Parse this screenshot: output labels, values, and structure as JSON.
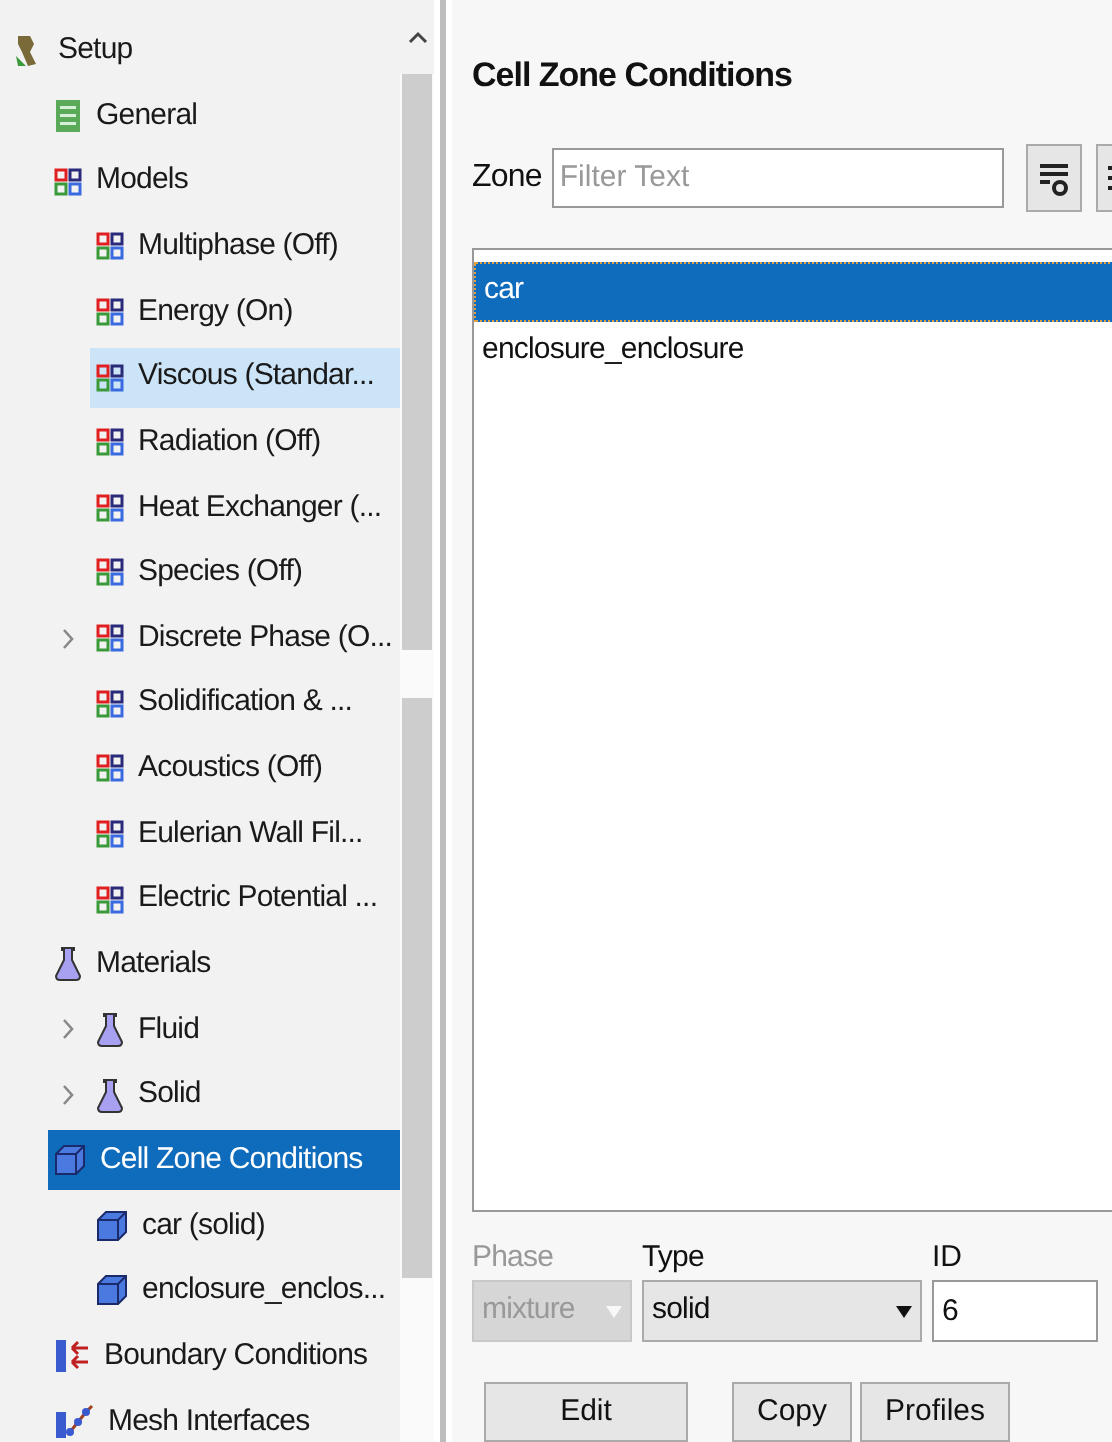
{
  "tree": [
    {
      "label": "Setup",
      "kind": "setup",
      "selected": false,
      "children": [
        {
          "label": "General",
          "kind": "general",
          "selected": false
        },
        {
          "label": "Models",
          "kind": "model",
          "selected": false,
          "children": [
            {
              "label": "Multiphase (Off)",
              "kind": "model",
              "selected": false
            },
            {
              "label": "Energy (On)",
              "kind": "model",
              "selected": false
            },
            {
              "label": "Viscous (Standar...",
              "kind": "model",
              "selected": false,
              "hovered": true
            },
            {
              "label": "Radiation (Off)",
              "kind": "model",
              "selected": false
            },
            {
              "label": "Heat Exchanger (...",
              "kind": "model",
              "selected": false
            },
            {
              "label": "Species (Off)",
              "kind": "model",
              "selected": false
            },
            {
              "label": "Discrete Phase (O...",
              "kind": "model",
              "selected": false,
              "expanded": false
            },
            {
              "label": "Solidification & ...",
              "kind": "model",
              "selected": false
            },
            {
              "label": "Acoustics (Off)",
              "kind": "model",
              "selected": false
            },
            {
              "label": "Eulerian Wall Fil...",
              "kind": "model",
              "selected": false
            },
            {
              "label": "Electric Potential ...",
              "kind": "model",
              "selected": false
            }
          ]
        },
        {
          "label": "Materials",
          "kind": "material",
          "selected": false,
          "children": [
            {
              "label": "Fluid",
              "kind": "material",
              "selected": false,
              "expanded": false
            },
            {
              "label": "Solid",
              "kind": "material",
              "selected": false,
              "expanded": false
            }
          ]
        },
        {
          "label": "Cell Zone Conditions",
          "kind": "cellzone",
          "selected": true,
          "children": [
            {
              "label": "car (solid)",
              "kind": "cellzone",
              "selected": false
            },
            {
              "label": "enclosure_enclos...",
              "kind": "cellzone",
              "selected": false
            }
          ]
        },
        {
          "label": "Boundary Conditions",
          "kind": "boundary",
          "selected": false
        },
        {
          "label": "Mesh Interfaces",
          "kind": "mesh",
          "selected": false
        }
      ]
    }
  ],
  "panel": {
    "title": "Cell Zone Conditions",
    "zone_label": "Zone",
    "filter": {
      "placeholder": "Filter Text"
    },
    "zones": [
      {
        "label": "car",
        "selected": true
      },
      {
        "label": "enclosure_enclosure",
        "selected": false
      }
    ],
    "phase": {
      "label": "Phase",
      "value": "mixture",
      "disabled": true
    },
    "type": {
      "label": "Type",
      "value": "solid",
      "disabled": false
    },
    "id": {
      "label": "ID",
      "value": "6"
    },
    "buttons": [
      "Edit",
      "Copy",
      "Profiles"
    ]
  }
}
